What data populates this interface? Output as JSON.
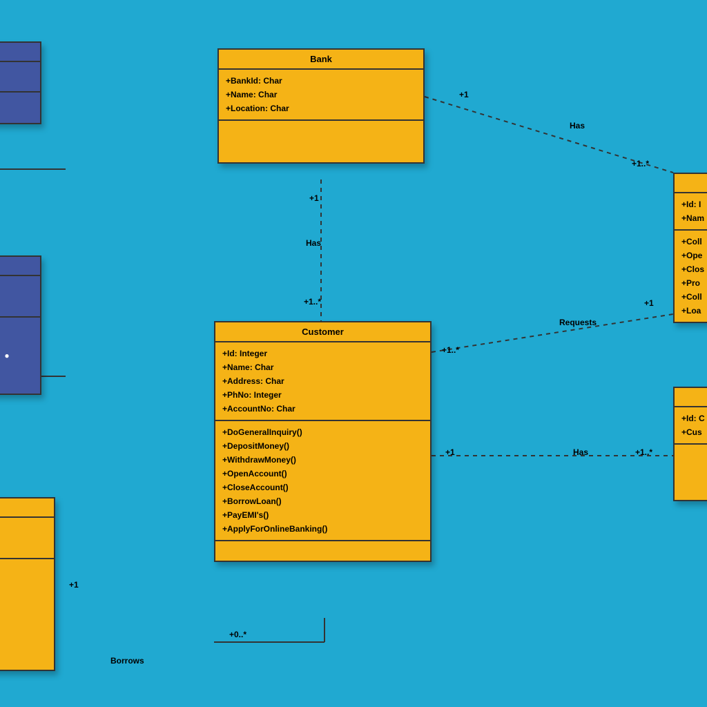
{
  "classes": {
    "bank": {
      "name": "Bank",
      "attributes": [
        "+BankId: Char",
        "+Name: Char",
        "+Location: Char"
      ],
      "methods": []
    },
    "customer": {
      "name": "Customer",
      "attributes": [
        "+Id: Integer",
        "+Name: Char",
        "+Address: Char",
        "+PhNo: Integer",
        "+AccountNo: Char"
      ],
      "methods": [
        "+DoGeneralInquiry()",
        "+DepositMoney()",
        "+WithdrawMoney()",
        "+OpenAccount()",
        "+CloseAccount()",
        "+BorrowLoan()",
        "+PayEMI's()",
        "+ApplyForOnlineBanking()"
      ]
    },
    "rightTop": {
      "attributes": [
        "+Id: I",
        "+Nam"
      ],
      "methods": [
        "+Coll",
        "+Ope",
        "+Clos",
        "+Pro",
        "+Coll",
        "+Loa"
      ]
    },
    "rightBottom": {
      "attributes": [
        "+Id: C",
        "+Cus"
      ]
    }
  },
  "relationships": {
    "bank_has_right": {
      "label": "Has",
      "mult_left": "+1",
      "mult_right": "+1..*"
    },
    "bank_has_customer": {
      "label": "Has",
      "mult_top": "+1",
      "mult_bottom": "+1..*"
    },
    "customer_requests": {
      "label": "Requests",
      "mult_left": "+1..*"
    },
    "customer_has_right": {
      "label": "Has",
      "mult_left": "+1",
      "mult_right": "+1..*"
    },
    "customer_borrows": {
      "label": "Borrows",
      "mult_left": "+1",
      "mult_right": "+0..*"
    }
  }
}
